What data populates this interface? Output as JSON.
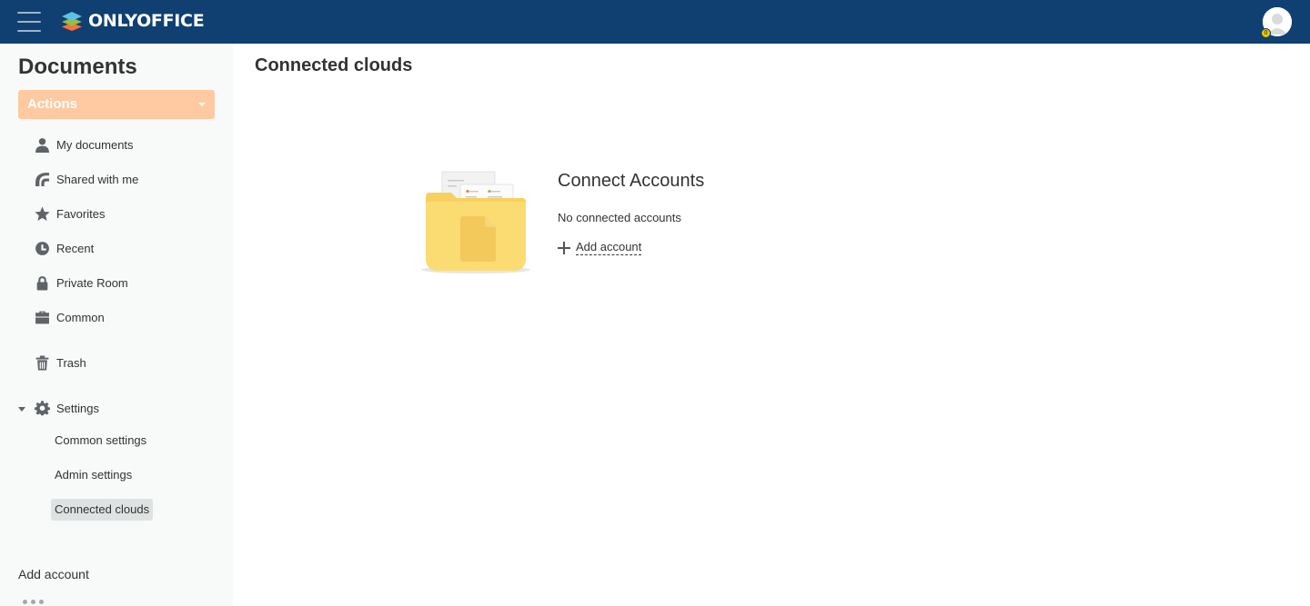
{
  "header": {
    "menu_icon": "hamburger-icon",
    "logo_text": "ONLYOFFICE",
    "logo_colors": [
      "#ff6f3d",
      "#95c038",
      "#5dc0e8"
    ],
    "avatar_icon": "user-avatar-icon",
    "background": "#0f4071"
  },
  "sidebar": {
    "title": "Documents",
    "actions_label": "Actions",
    "actions_color": "#ffc9a1",
    "items": [
      {
        "label": "My documents",
        "icon": "user-icon"
      },
      {
        "label": "Shared with me",
        "icon": "shared-icon"
      },
      {
        "label": "Favorites",
        "icon": "star-icon"
      },
      {
        "label": "Recent",
        "icon": "clock-icon"
      },
      {
        "label": "Private Room",
        "icon": "lock-icon"
      },
      {
        "label": "Common",
        "icon": "briefcase-icon"
      },
      {
        "label": "Trash",
        "icon": "trash-icon"
      },
      {
        "label": "Settings",
        "icon": "gear-icon"
      }
    ],
    "settings_items": [
      {
        "label": "Common settings"
      },
      {
        "label": "Admin settings"
      },
      {
        "label": "Connected clouds",
        "active": true
      }
    ],
    "add_account": "Add account"
  },
  "main": {
    "title": "Connected clouds",
    "empty": {
      "title": "Connect Accounts",
      "subtitle": "No connected accounts",
      "add_label": "Add account",
      "image_icon": "folder-icon"
    }
  }
}
